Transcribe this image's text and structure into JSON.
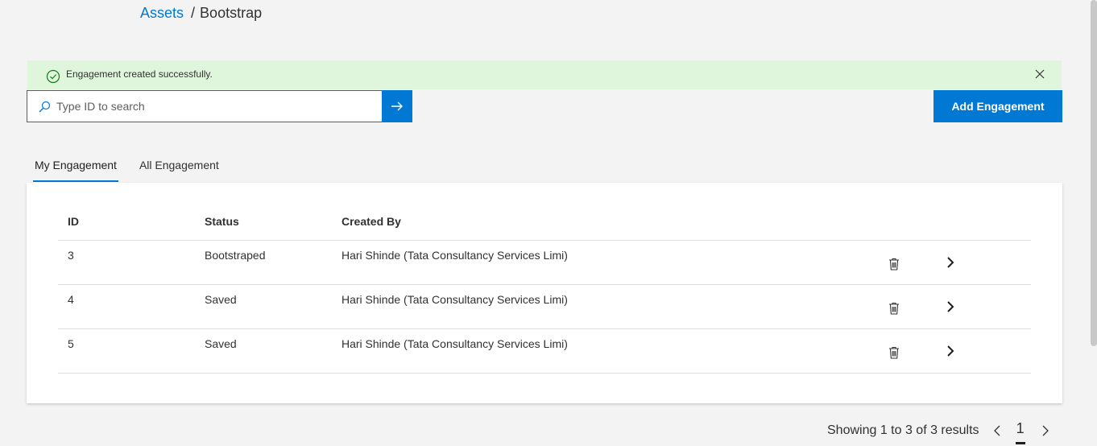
{
  "breadcrumb": {
    "parent": "Assets",
    "separator": "/",
    "current": "Bootstrap"
  },
  "banner": {
    "message": "Engagement created successfully.",
    "color": "#dff6dd"
  },
  "search": {
    "placeholder": "Type ID to search"
  },
  "actions": {
    "add_label": "Add Engagement"
  },
  "tabs": [
    {
      "label": "My Engagement",
      "active": true
    },
    {
      "label": "All Engagement",
      "active": false
    }
  ],
  "table": {
    "columns": [
      "ID",
      "Status",
      "Created By"
    ],
    "rows": [
      {
        "id": "3",
        "status": "Bootstraped",
        "created_by": "Hari Shinde (Tata Consultancy Services Limi)"
      },
      {
        "id": "4",
        "status": "Saved",
        "created_by": "Hari Shinde (Tata Consultancy Services Limi)"
      },
      {
        "id": "5",
        "status": "Saved",
        "created_by": "Hari Shinde (Tata Consultancy Services Limi)"
      }
    ]
  },
  "pagination": {
    "summary": "Showing 1 to 3 of 3 results",
    "current_page": "1"
  },
  "colors": {
    "accent": "#0078d4",
    "success_bg": "#dff6dd",
    "success_icon": "#107c10"
  }
}
